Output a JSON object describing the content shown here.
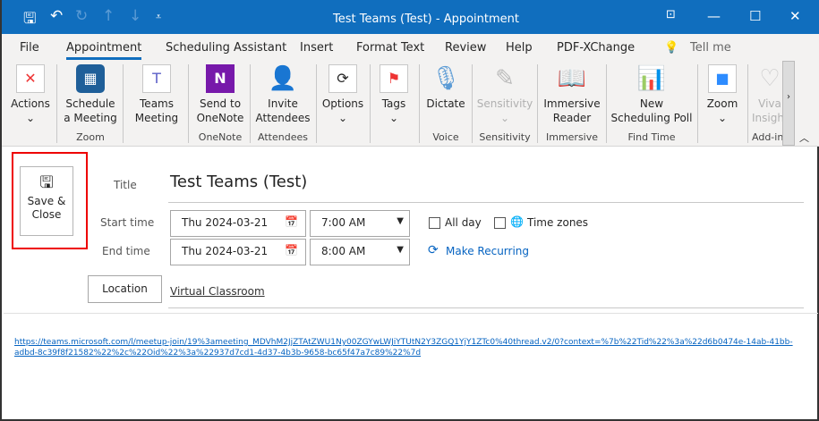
{
  "window": {
    "title": "Test Teams (Test)  -  Appointment",
    "quick_access": [
      "save-icon",
      "undo-icon",
      "redo-icon",
      "up-icon",
      "down-icon",
      "customize-icon"
    ]
  },
  "menu": {
    "tabs": [
      "File",
      "Appointment",
      "Scheduling Assistant",
      "Insert",
      "Format Text",
      "Review",
      "Help",
      "PDF-XChange"
    ],
    "active": "Appointment",
    "tell_me": "Tell me"
  },
  "ribbon": {
    "actions": "Actions",
    "schedule": "Schedule a Meeting",
    "teams": "Teams Meeting",
    "onenote": "Send to OneNote",
    "invite": "Invite Attendees",
    "options": "Options",
    "tags": "Tags",
    "dictate": "Dictate",
    "sensitivity": "Sensitivity",
    "immersive": "Immersive Reader",
    "poll": "New Scheduling Poll",
    "zoom": "Zoom",
    "viva": "Viva Insights",
    "groups": {
      "zoom": "Zoom",
      "onenote": "OneNote",
      "attendees": "Attendees",
      "voice": "Voice",
      "sensitivity": "Sensitivity",
      "immersive": "Immersive",
      "findtime": "Find Time",
      "addins": "Add-ins"
    }
  },
  "form": {
    "save_close": "Save & Close",
    "title_label": "Title",
    "title_value": "Test Teams (Test)",
    "start_label": "Start time",
    "start_date": "Thu 2024-03-21",
    "start_time": "7:00 AM",
    "end_label": "End time",
    "end_date": "Thu 2024-03-21",
    "end_time": "8:00 AM",
    "all_day": "All day",
    "all_day_checked": false,
    "time_zones": "Time zones",
    "time_zones_checked": false,
    "make_recurring": "Make Recurring",
    "location_button": "Location",
    "location_value": "Virtual Classroom"
  },
  "body": {
    "link": "https://teams.microsoft.com/l/meetup-join/19%3ameeting_MDVhM2JjZTAtZWU1Ny00ZGYwLWJiYTUtN2Y3ZGQ1YjY1ZTc0%40thread.v2/0?context=%7b%22Tid%22%3a%22d6b0474e-14ab-41bb-adbd-8c39f8f21582%22%2c%22Oid%22%3a%22937d7cd1-4d37-4b3b-9658-bc65f47a7c89%22%7d"
  },
  "colors": {
    "accent": "#106ebe",
    "highlight_box": "#e00000",
    "link": "#0563c1"
  }
}
